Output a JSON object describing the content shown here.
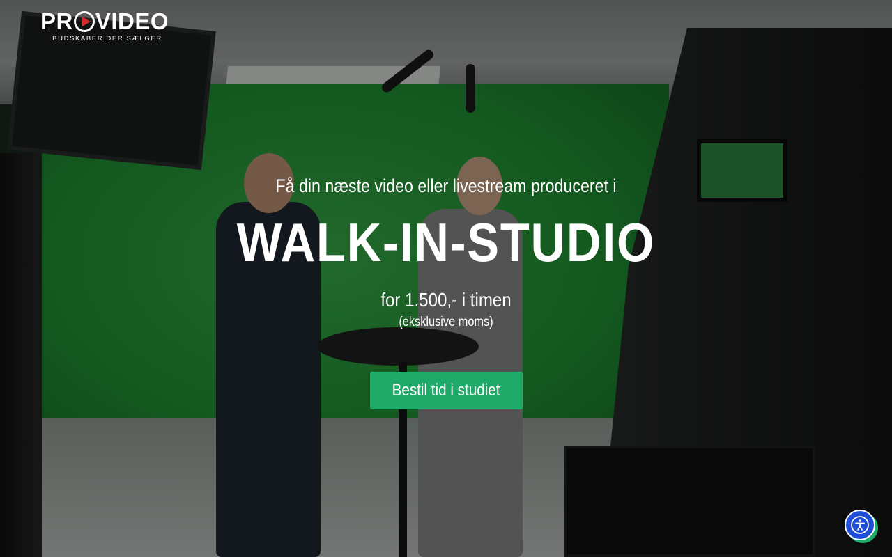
{
  "logo": {
    "brand_pre": "PR",
    "brand_post": "VIDEO",
    "tagline": "BUDSKABER DER SÆLGER",
    "play_icon": "play-circle-icon"
  },
  "hero": {
    "intro": "Få din næste video eller livestream produceret i",
    "title": "WALK-IN-STUDIO",
    "price": "for 1.500,- i timen",
    "vat_note": "(eksklusive moms)",
    "cta_label": "Bestil tid i studiet"
  },
  "accessibility": {
    "icon": "accessibility-icon",
    "aria_label": "Accessibility"
  },
  "colors": {
    "cta": "#1faa6a",
    "accessibility": "#1f4fd8",
    "logo_accent": "#d62b2b",
    "text": "#ffffff"
  }
}
